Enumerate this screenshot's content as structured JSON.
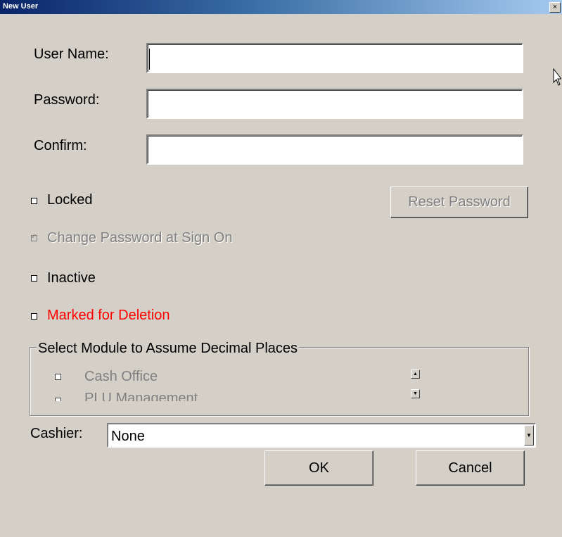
{
  "window": {
    "title": "New User",
    "close_glyph": "×"
  },
  "fields": {
    "user_name_label": "User Name:",
    "user_name_value": "",
    "password_label": "Password:",
    "password_value": "",
    "confirm_label": "Confirm:",
    "confirm_value": ""
  },
  "options": {
    "locked": {
      "label": "Locked",
      "checked": false
    },
    "change_password": {
      "label": "Change Password at Sign On",
      "checked": true,
      "disabled": true
    },
    "inactive": {
      "label": "Inactive",
      "checked": false
    },
    "marked_for_deletion": {
      "label": "Marked for Deletion",
      "checked": false,
      "color": "#ff0000"
    }
  },
  "buttons": {
    "reset_password": "Reset Password",
    "ok": "OK",
    "cancel": "Cancel"
  },
  "module_group": {
    "title": "Select Module to Assume Decimal Places",
    "items": [
      {
        "label": "Cash Office",
        "checked": false
      },
      {
        "label": "PLU Management",
        "checked": false
      }
    ]
  },
  "cashier": {
    "label": "Cashier:",
    "value": "None"
  },
  "colors": {
    "titlebar_start": "#0a246a",
    "titlebar_end": "#a6caf0",
    "dialog_bg": "#d4d0c8",
    "alert": "#ff0000"
  },
  "icons": {
    "scroll_up": "scroll-up-arrow-icon",
    "scroll_down": "scroll-down-arrow-icon",
    "dropdown": "chevron-down-icon",
    "pointer": "mouse-pointer-icon"
  }
}
